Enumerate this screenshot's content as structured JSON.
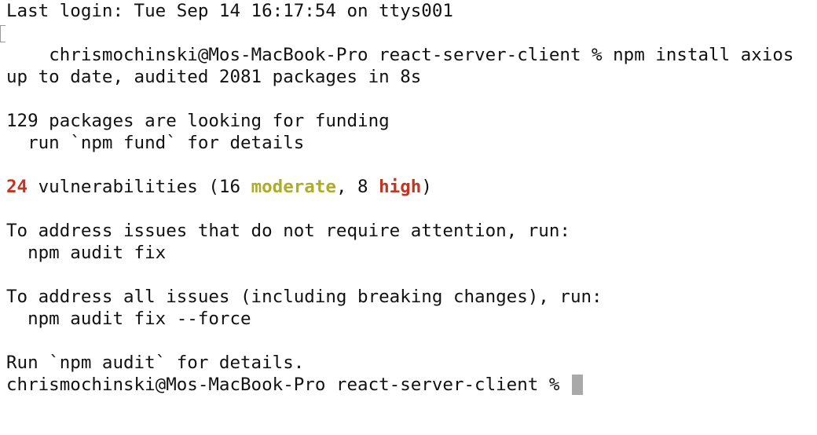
{
  "terminal": {
    "last_login": "Last login: Tue Sep 14 16:17:54 on ttys001",
    "prompt": "chrismochinski@Mos-MacBook-Pro react-server-client % ",
    "command": "npm install axios",
    "blank": "",
    "up_to_date": "up to date, audited 2081 packages in 8s",
    "funding_line": "129 packages are looking for funding",
    "fund_hint": "  run `npm fund` for details",
    "vuln_count": "24",
    "vuln_text_pre": " vulnerabilities (16 ",
    "vuln_moderate": "moderate",
    "vuln_text_mid": ", 8 ",
    "vuln_high": "high",
    "vuln_text_post": ")",
    "address_noattention": "To address issues that do not require attention, run:",
    "cmd_audit_fix": "  npm audit fix",
    "address_all": "To address all issues (including breaking changes), run:",
    "cmd_audit_fix_force": "  npm audit fix --force",
    "run_audit": "Run `npm audit` for details.",
    "final_prompt": "chrismochinski@Mos-MacBook-Pro react-server-client % "
  },
  "colors": {
    "text": "#111111",
    "error_red": "#c23621",
    "warning_yellow": "#adad27",
    "cursor": "#a9a9a9",
    "background": "#ffffff"
  }
}
